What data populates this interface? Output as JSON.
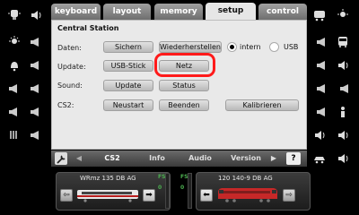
{
  "tabs": [
    {
      "label": "keyboard",
      "active": false
    },
    {
      "label": "layout",
      "active": false
    },
    {
      "label": "memory",
      "active": false
    },
    {
      "label": "setup",
      "active": true
    },
    {
      "label": "control",
      "active": false
    }
  ],
  "panel": {
    "title": "Central Station",
    "rows": [
      {
        "label": "Daten:",
        "buttons": [
          "Sichern",
          "Wiederherstellen"
        ]
      },
      {
        "label": "Update:",
        "buttons": [
          "USB-Stick",
          "Netz"
        ]
      },
      {
        "label": "Sound:",
        "buttons": [
          "Update",
          "Status"
        ]
      },
      {
        "label": "CS2:",
        "buttons": [
          "Neustart",
          "Beenden",
          "Kalibrieren"
        ]
      }
    ],
    "storage": {
      "options": [
        "intern",
        "USB"
      ],
      "selected": "intern"
    }
  },
  "subbar": {
    "items": [
      "CS2",
      "Info",
      "Audio",
      "Version"
    ],
    "active": "CS2",
    "help_label": "?"
  },
  "locos": [
    {
      "name": "WRmz 135 DB AG",
      "fs_label": "FS",
      "fs_value": "0"
    },
    {
      "name": "120 140-9 DB AG",
      "fs_label": "FS",
      "fs_value": "0"
    }
  ],
  "colors": {
    "highlight": "#ff1a1a",
    "loco_red": "#c62828",
    "fs_green": "#4caf50"
  },
  "icons": {
    "left_rail": [
      "lamp-icon",
      "light-icon",
      "bell-icon",
      "horn-icon",
      "horn-icon",
      "horn-icon",
      "horn-icon",
      "horn-icon",
      "whistle-icon",
      "horn-icon"
    ],
    "right_rail": [
      "train-icon",
      "lamp-icon",
      "bus-icon",
      "sound-icon",
      "horn-icon",
      "horn-icon",
      "person-icon",
      "sound-icon",
      "car-icon",
      "sound-icon"
    ]
  }
}
